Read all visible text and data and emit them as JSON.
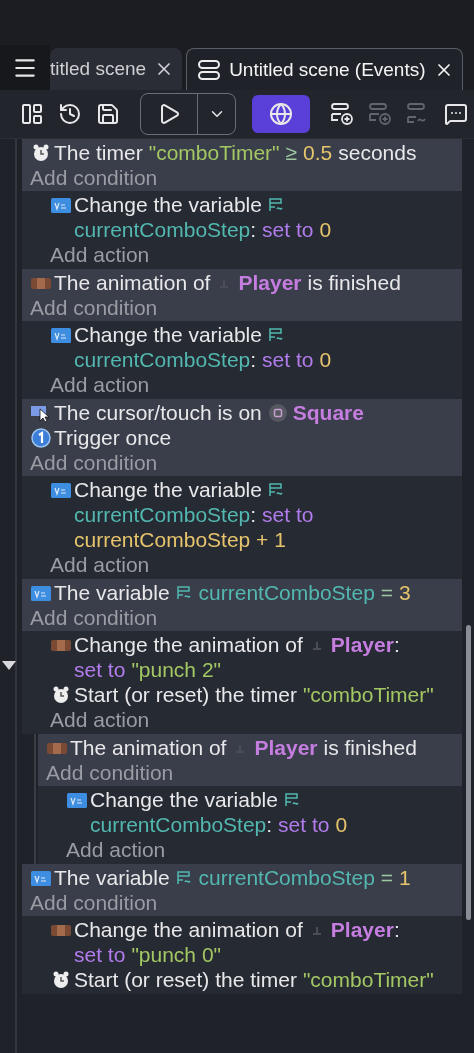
{
  "tabs": [
    {
      "label": "titled scene",
      "selected": false,
      "kind": "scene"
    },
    {
      "label": "Untitled scene (Events)",
      "selected": true,
      "kind": "events"
    }
  ],
  "toolbar": [
    {
      "kind": "layout",
      "disabled": false
    },
    {
      "kind": "history",
      "disabled": false
    },
    {
      "kind": "save",
      "disabled": false
    },
    {
      "kind": "play",
      "disabled": false
    },
    {
      "kind": "dropdown",
      "disabled": false
    },
    {
      "kind": "globe",
      "disabled": false
    },
    {
      "kind": "add-event",
      "disabled": false
    },
    {
      "kind": "add-subevent",
      "disabled": true
    },
    {
      "kind": "add-link",
      "disabled": true
    },
    {
      "kind": "comment",
      "disabled": false
    }
  ],
  "events": [
    {
      "conditions": [
        {
          "kind": "timer",
          "parts": [
            {
              "kind": "plain",
              "text": "The timer"
            },
            {
              "kind": "string",
              "text": "\"comboTimer\""
            },
            {
              "kind": "operator",
              "text": "≥"
            },
            {
              "kind": "number",
              "text": "0.5"
            },
            {
              "kind": "plain",
              "text": "seconds"
            }
          ]
        }
      ],
      "add_condition": "Add condition",
      "actions": [
        {
          "kind": "variable",
          "parts": [
            {
              "kind": "plain",
              "text": "Change the variable"
            },
            {
              "kind": "variable-icon"
            },
            {
              "kind": "variable",
              "text": "currentComboStep"
            },
            {
              "kind": "colon",
              "text": ":"
            },
            {
              "kind": "keyword",
              "text": "set to"
            },
            {
              "kind": "number",
              "text": "0"
            }
          ]
        }
      ],
      "add_action": "Add action"
    },
    {
      "conditions": [
        {
          "kind": "animation",
          "parts": [
            {
              "kind": "plain",
              "text": "The animation of"
            },
            {
              "kind": "object-icon"
            },
            {
              "kind": "object",
              "text": "Player"
            },
            {
              "kind": "plain",
              "text": "is finished"
            }
          ]
        }
      ],
      "add_condition": "Add condition",
      "actions": [
        {
          "kind": "variable",
          "parts": [
            {
              "kind": "plain",
              "text": "Change the variable"
            },
            {
              "kind": "variable-icon"
            },
            {
              "kind": "variable",
              "text": "currentComboStep"
            },
            {
              "kind": "colon",
              "text": ":"
            },
            {
              "kind": "keyword",
              "text": "set to"
            },
            {
              "kind": "number",
              "text": "0"
            }
          ]
        }
      ],
      "add_action": "Add action"
    },
    {
      "conditions": [
        {
          "kind": "cursor",
          "parts": [
            {
              "kind": "plain",
              "text": "The cursor/touch is on"
            },
            {
              "kind": "shape-icon"
            },
            {
              "kind": "object",
              "text": "Square"
            }
          ]
        },
        {
          "kind": "once",
          "parts": [
            {
              "kind": "plain",
              "text": "Trigger once"
            }
          ]
        }
      ],
      "add_condition": "Add condition",
      "actions": [
        {
          "kind": "variable",
          "parts": [
            {
              "kind": "plain",
              "text": "Change the variable"
            },
            {
              "kind": "variable-icon"
            },
            {
              "kind": "variable",
              "text": "currentComboStep"
            },
            {
              "kind": "colon",
              "text": ":"
            },
            {
              "kind": "keyword",
              "text": "set to"
            },
            {
              "kind": "number",
              "text": "currentComboStep + 1"
            }
          ]
        }
      ],
      "add_action": "Add action"
    },
    {
      "conditions": [
        {
          "kind": "variable",
          "parts": [
            {
              "kind": "plain",
              "text": "The variable"
            },
            {
              "kind": "variable-icon"
            },
            {
              "kind": "variable",
              "text": "currentComboStep"
            },
            {
              "kind": "operator",
              "text": "="
            },
            {
              "kind": "number",
              "text": "3"
            }
          ]
        }
      ],
      "add_condition": "Add condition",
      "actions": [
        {
          "kind": "animation",
          "parts": [
            {
              "kind": "plain",
              "text": "Change the animation of"
            },
            {
              "kind": "object-icon"
            },
            {
              "kind": "object",
              "text": "Player"
            },
            {
              "kind": "colon",
              "text": ":"
            },
            {
              "kind": "keyword",
              "text": "set to"
            },
            {
              "kind": "string",
              "text": "\"punch 2\""
            }
          ]
        },
        {
          "kind": "timer",
          "parts": [
            {
              "kind": "plain",
              "text": "Start (or reset) the timer"
            },
            {
              "kind": "string",
              "text": "\"comboTimer\""
            }
          ]
        }
      ],
      "add_action": "Add action",
      "children": [
        {
          "conditions": [
            {
              "kind": "animation",
              "parts": [
                {
                  "kind": "plain",
                  "text": "The animation of"
                },
                {
                  "kind": "object-icon"
                },
                {
                  "kind": "object",
                  "text": "Player"
                },
                {
                  "kind": "plain",
                  "text": "is finished"
                }
              ]
            }
          ],
          "add_condition": "Add condition",
          "actions": [
            {
              "kind": "variable",
              "parts": [
                {
                  "kind": "plain",
                  "text": "Change the variable"
                },
                {
                  "kind": "variable-icon"
                },
                {
                  "kind": "variable",
                  "text": "currentComboStep"
                },
                {
                  "kind": "colon",
                  "text": ":"
                },
                {
                  "kind": "keyword",
                  "text": "set to"
                },
                {
                  "kind": "number",
                  "text": "0"
                }
              ]
            }
          ],
          "add_action": "Add action"
        }
      ]
    },
    {
      "conditions": [
        {
          "kind": "variable",
          "parts": [
            {
              "kind": "plain",
              "text": "The variable"
            },
            {
              "kind": "variable-icon"
            },
            {
              "kind": "variable",
              "text": "currentComboStep"
            },
            {
              "kind": "operator",
              "text": "="
            },
            {
              "kind": "number",
              "text": "1"
            }
          ]
        }
      ],
      "add_condition": "Add condition",
      "actions": [
        {
          "kind": "animation",
          "parts": [
            {
              "kind": "plain",
              "text": "Change the animation of"
            },
            {
              "kind": "object-icon"
            },
            {
              "kind": "object",
              "text": "Player"
            },
            {
              "kind": "colon",
              "text": ":"
            },
            {
              "kind": "keyword",
              "text": "set to"
            },
            {
              "kind": "string",
              "text": "\"punch 0\""
            }
          ]
        },
        {
          "kind": "timer",
          "parts": [
            {
              "kind": "plain",
              "text": "Start (or reset) the timer"
            },
            {
              "kind": "string",
              "text": "\"comboTimer\""
            }
          ]
        }
      ]
    }
  ]
}
